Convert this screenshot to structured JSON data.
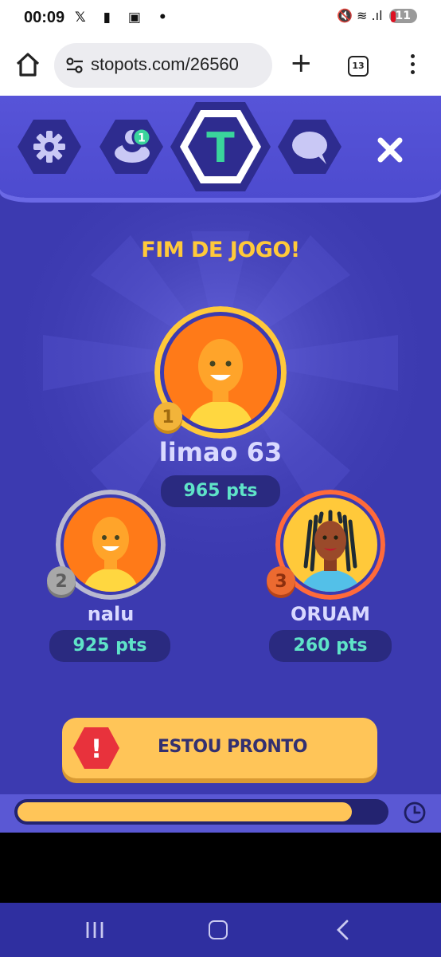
{
  "statusbar": {
    "time": "00:09",
    "left_icons": "𝕏 ▮ ▣ •",
    "right_icons": "🔇 ≋ .ıl",
    "battery": "11"
  },
  "browser": {
    "url": "stopots.com/26560",
    "tab_count": "13"
  },
  "game": {
    "letter": "T",
    "players_badge": "1",
    "title": "FIM DE JOGO!",
    "podium": [
      {
        "rank": "1",
        "name": "limao 63",
        "points": "965 pts"
      },
      {
        "rank": "2",
        "name": "nalu",
        "points": "925 pts"
      },
      {
        "rank": "3",
        "name": "ORUAM",
        "points": "260 pts"
      }
    ],
    "ready_button": "ESTOU PRONTO",
    "ready_warning": "!",
    "timer_progress": 0.91
  },
  "colors": {
    "background": "#3c3ab0",
    "accent_yellow": "#ffc558",
    "title_yellow": "#ffc93a",
    "points_green": "#5fe4c8",
    "letter_green": "#3ad49c"
  }
}
